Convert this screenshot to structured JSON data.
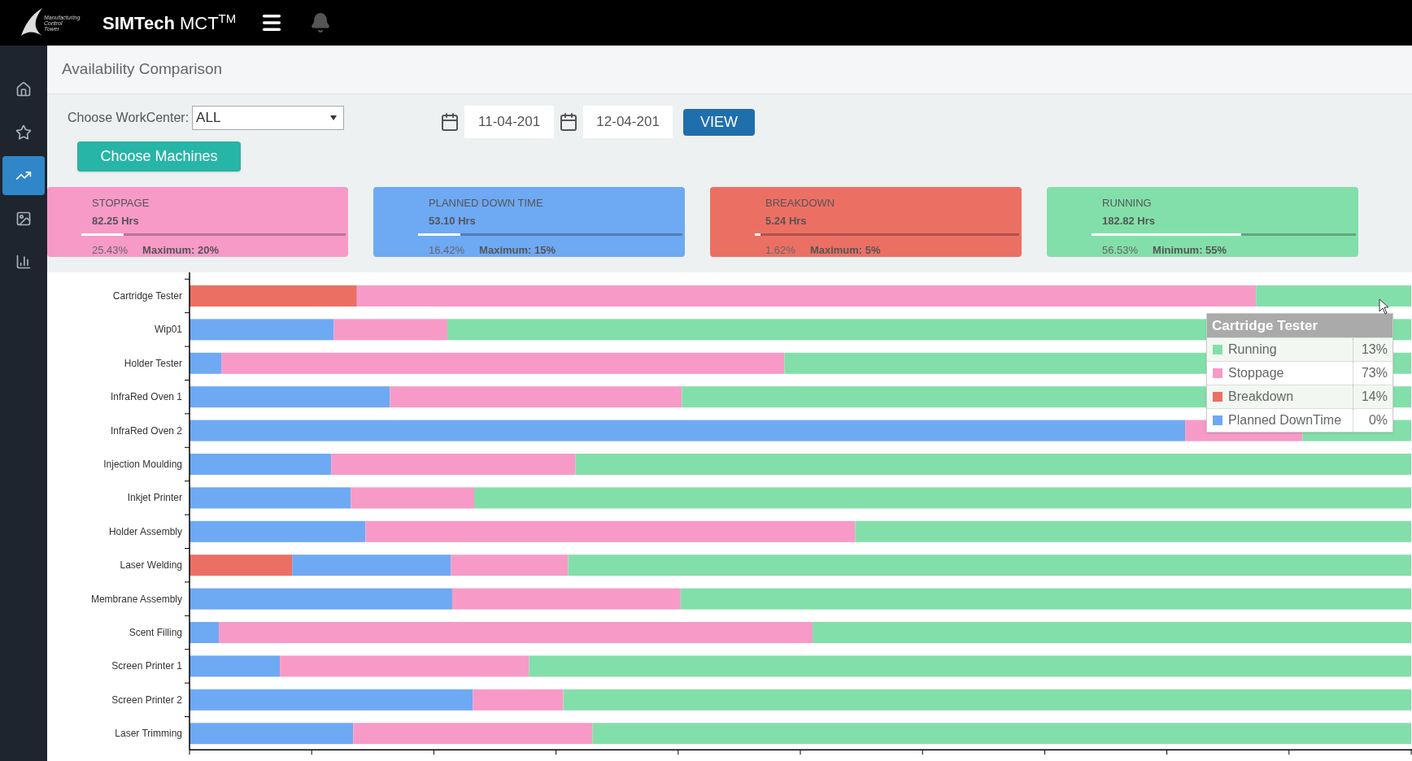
{
  "header": {
    "logo_lines": [
      "Manufacturing",
      "Control",
      "Tower"
    ],
    "brand": "SIMTech",
    "product": "MCT",
    "mark": "TM"
  },
  "sidebar": {
    "items": [
      {
        "kind": "home",
        "selected": false
      },
      {
        "kind": "star",
        "selected": false
      },
      {
        "kind": "trend",
        "selected": true
      },
      {
        "kind": "image",
        "selected": false
      },
      {
        "kind": "bars",
        "selected": false
      }
    ]
  },
  "page_title": "Availability Comparison",
  "filters": {
    "workcenter_label": "Choose WorkCenter:",
    "workcenter_value": "ALL",
    "date_from": "11-04-201",
    "date_to": "12-04-201",
    "view_button": "VIEW",
    "machines_button": "Choose Machines"
  },
  "cards": [
    {
      "title": "STOPPAGE",
      "hours": "82.25 Hrs",
      "level": 0.16,
      "percent": "25.43%",
      "limit": "Maximum: 20%",
      "color": "#f79ac8"
    },
    {
      "title": "PLANNED DOWN TIME",
      "hours": "53.10 Hrs",
      "level": 0.16,
      "percent": "16.42%",
      "limit": "Maximum: 15%",
      "color": "#6ea9f4"
    },
    {
      "title": "BREAKDOWN",
      "hours": "5.24 Hrs",
      "level": 0.02,
      "percent": "1.62%",
      "limit": "Maximum: 5%",
      "color": "#ec6f64"
    },
    {
      "title": "RUNNING",
      "hours": "182.82 Hrs",
      "level": 0.565,
      "percent": "56.53%",
      "limit": "Minimum: 55%",
      "color": "#83dfa9"
    }
  ],
  "chart": {
    "row_labels": [
      "Cartridge Tester",
      "Wip01",
      "Holder Tester",
      "InfraRed Oven 1",
      "InfraRed Oven 2",
      "Injection Moulding",
      "Inkjet Printer",
      "Holder Assembly",
      "Laser Welding",
      "Membrane Assembly",
      "Scent Filling",
      "Screen Printer 1",
      "Screen Printer 2",
      "Laser Trimming"
    ],
    "kind": "picture"
  },
  "tooltip": {
    "title": "Cartridge Tester",
    "items": [
      {
        "label": "Running",
        "value": "13%",
        "color": "#83dfa9"
      },
      {
        "label": "Stoppage",
        "value": "73%",
        "color": "#f79ac8"
      },
      {
        "label": "Breakdown",
        "value": "14%",
        "color": "#ec6f64"
      },
      {
        "label": "Planned DownTime",
        "value": "0%",
        "color": "#6ea9f4"
      }
    ]
  }
}
